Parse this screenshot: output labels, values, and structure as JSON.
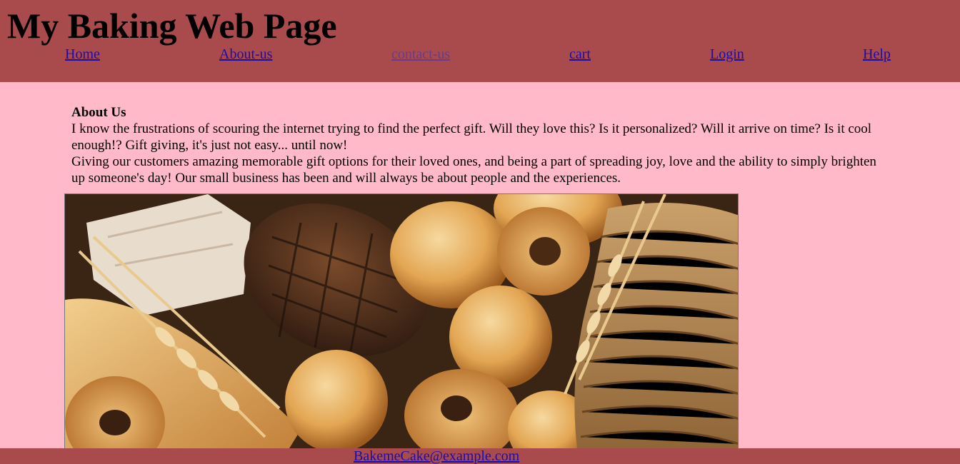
{
  "header": {
    "title": "My Baking Web Page",
    "background": "#a94b4d"
  },
  "nav": {
    "items": [
      {
        "label": "Home"
      },
      {
        "label": "About-us"
      },
      {
        "label": "contact-us"
      },
      {
        "label": "cart"
      },
      {
        "label": "Login"
      },
      {
        "label": "Help"
      }
    ],
    "link_color": "#1a0dab",
    "visited_color": "#6b3a8a"
  },
  "about": {
    "heading": "About Us",
    "paragraph1": "I know the frustrations of scouring the internet trying to find the perfect gift. Will they love this? Is it personalized? Will it arrive on time? Is it cool enough!? Gift giving, it's just not easy... until now!",
    "paragraph2": "Giving our customers amazing memorable gift options for their loved ones, and being a part of spreading joy, love and the ability to simply brighten up someone's day! Our small business has been and will always be about people and the experiences."
  },
  "image": {
    "subject": "assorted-bread-photo"
  },
  "footer": {
    "email": "BakemeCake@example.com"
  },
  "colors": {
    "page_background": "#ffb9c8",
    "bar": "#a94b4d"
  }
}
